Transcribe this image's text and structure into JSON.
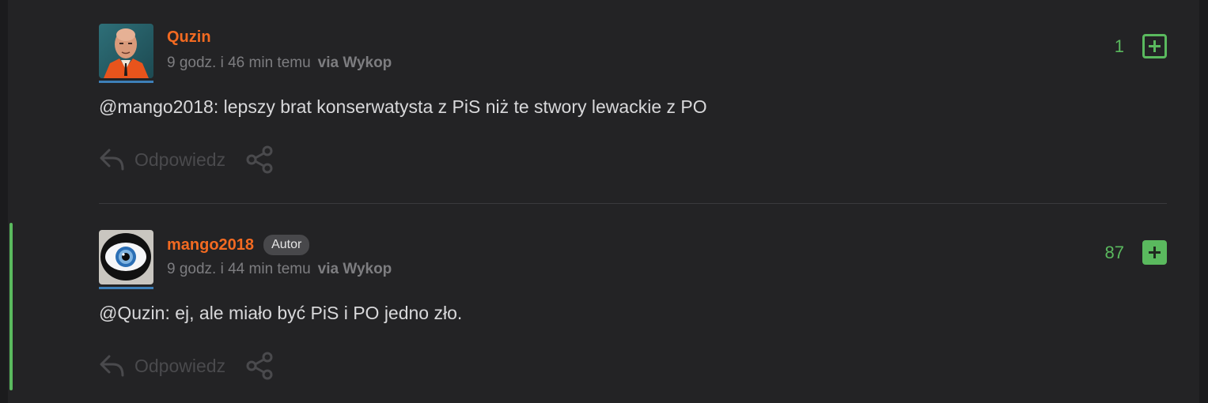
{
  "comments": [
    {
      "username": "Quzin",
      "badge": "",
      "time": "9 godz. i 46 min temu",
      "via": "via Wykop",
      "votes": "1",
      "mention": "@mango2018",
      "text": ": lepszy brat konserwatysta z PiS niż te stwory lewackie z PO",
      "reply_label": "Odpowiedz"
    },
    {
      "username": "mango2018",
      "badge": "Autor",
      "time": "9 godz. i 44 min temu",
      "via": "via Wykop",
      "votes": "87",
      "mention": "@Quzin",
      "text": ": ej, ale miało być PiS i PO jedno zło.",
      "reply_label": "Odpowiedz"
    }
  ],
  "colors": {
    "username": "#f36a21",
    "vote_green": "#5ab95e",
    "thread_bar": "#5ab95e",
    "avatar_underline": "#3d7fb8"
  },
  "icons": {
    "reply": "reply-arrow-icon",
    "share": "share-icon",
    "upvote": "plus-icon"
  }
}
